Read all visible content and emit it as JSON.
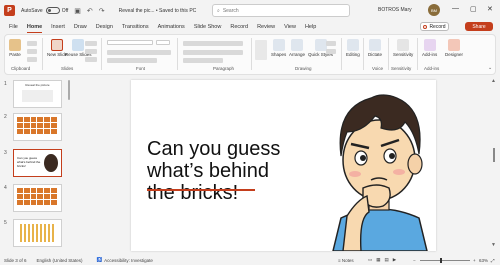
{
  "titlebar": {
    "autosave_label": "AutoSave",
    "autosave_state": "Off",
    "doc_title": "Reveal the pic... • Saved to this PC",
    "search_placeholder": "Search",
    "user_name": "BOTROS Mary",
    "avatar_initials": "BM"
  },
  "tabs": [
    "File",
    "Home",
    "Insert",
    "Draw",
    "Design",
    "Transitions",
    "Animations",
    "Slide Show",
    "Record",
    "Review",
    "View",
    "Help"
  ],
  "active_tab": "Home",
  "record_label": "Record",
  "share_label": "Share",
  "ribbon": {
    "paste": "Paste",
    "new_slide": "New Slide",
    "reuse_slides": "Reuse Slides",
    "shapes": "Shapes",
    "arrange": "Arrange",
    "quick_styles": "Quick Styles",
    "editing": "Editing",
    "dictate": "Dictate",
    "sensitivity": "Sensitivity",
    "add_ins": "Add-ins",
    "designer": "Designer",
    "groups": [
      "Clipboard",
      "Slides",
      "Font",
      "Paragraph",
      "Drawing",
      "Voice",
      "Sensitivity",
      "Add-ins"
    ]
  },
  "thumbnails": [
    {
      "num": "1",
      "label": "Reveal the picture"
    },
    {
      "num": "2",
      "label": ""
    },
    {
      "num": "3",
      "label": "Can you guess what's behind the bricks!"
    },
    {
      "num": "4",
      "label": ""
    },
    {
      "num": "5",
      "label": ""
    },
    {
      "num": "6",
      "label": ""
    }
  ],
  "slide": {
    "line1": "Can you guess",
    "line2": "what’s behind",
    "line3": "the bricks!"
  },
  "status": {
    "slide_info": "Slide 3 of 6",
    "language": "English (United States)",
    "accessibility": "Accessibility: Investigate",
    "notes": "Notes",
    "zoom": "63%"
  },
  "colors": {
    "accent": "#c43e1c",
    "brick": "#d9772a"
  }
}
